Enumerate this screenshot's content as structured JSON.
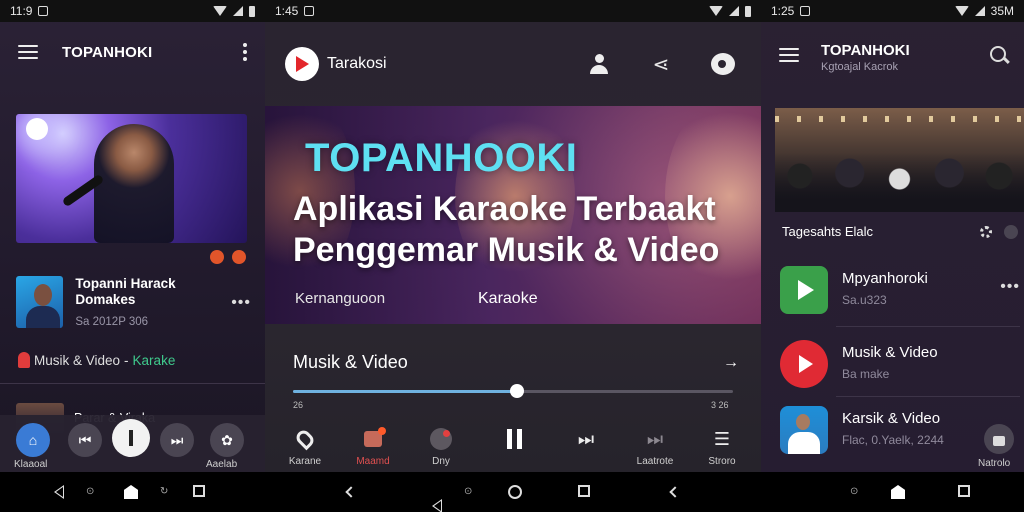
{
  "phone1": {
    "status": {
      "time": "11:9"
    },
    "appbar": {
      "title": "TOPANHOKI"
    },
    "track": {
      "title": "Topanni Harack Domakes",
      "sub": "Sa 2012P 306"
    },
    "category": {
      "label_a": "Musik & Video",
      "sep": " - ",
      "label_b": "Karake"
    },
    "mini": {
      "title": "Parar & Viraka"
    },
    "bar": {
      "left_label": "Klaaoal",
      "right_label": "Aaelab"
    },
    "colors": {
      "accent": "#e2552a",
      "green": "#3fc98c"
    }
  },
  "phone2": {
    "status": {
      "time": "1:45"
    },
    "brand": "Tarakosi",
    "hero": {
      "brand": "TOPANHOOKI",
      "line1": "Aplikasi Karaoke Terbaakt",
      "line2": "Penggemar Musik & Video",
      "tag1": "Kernanguoon",
      "tag2": "Karaoke"
    },
    "section": {
      "title": "Musik & Video",
      "arrow": "->"
    },
    "player": {
      "progress": 0.51,
      "time_start": "26",
      "time_end": "3 26"
    },
    "controls": [
      {
        "name": "karaoke-control",
        "icon": "location-icon",
        "label": "Karane"
      },
      {
        "name": "message-control",
        "icon": "message-icon",
        "label": "Maamd"
      },
      {
        "name": "disc-control",
        "icon": "disc-icon",
        "label": "Dny"
      },
      {
        "name": "pause-control",
        "icon": "pause-icon",
        "label": ""
      },
      {
        "name": "next-control",
        "icon": "skip-next-icon",
        "label": ""
      },
      {
        "name": "skip-control",
        "icon": "skip-next-icon",
        "label": "Laatrote"
      },
      {
        "name": "menu-control",
        "icon": "list-icon",
        "label": "Stroro"
      }
    ],
    "colors": {
      "hero_brand": "#5ee0f2",
      "progress": "#6fb2e0"
    }
  },
  "phone3": {
    "status": {
      "time": "1:25",
      "battery": "35M"
    },
    "appbar": {
      "title": "TOPANHOKI",
      "sub": "Kgtoajal Kacrok"
    },
    "rowhead": {
      "title": "Tagesahts Elalc"
    },
    "items": [
      {
        "title": "Mpyanhoroki",
        "sub": "Sa.u323",
        "icon": "play-store-icon"
      },
      {
        "title": "Musik & Video",
        "sub": "Ba make",
        "icon": "red-play-icon"
      },
      {
        "title": "Karsik & Video",
        "sub": "Flac, 0.Yaelk, 2244",
        "icon": "avatar-thumbnail"
      }
    ],
    "lock_label": "Natrolo"
  }
}
